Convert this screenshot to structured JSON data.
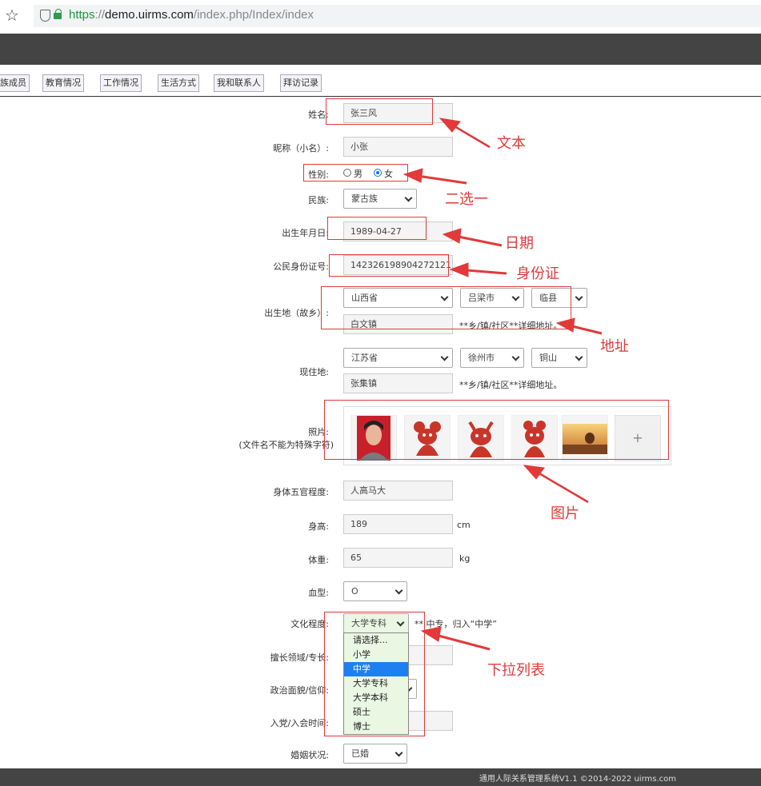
{
  "browser": {
    "url_scheme": "https",
    "url_sep": "://",
    "url_host": "demo.uirms.com",
    "url_path": "/index.php/Index/index"
  },
  "tabs": [
    "族成员",
    "教育情况",
    "工作情况",
    "生活方式",
    "我和联系人",
    "拜访记录"
  ],
  "form": {
    "name_label": "姓名:",
    "name_value": "张三风",
    "nickname_label": "昵称（小名）:",
    "nickname_value": "小张",
    "gender_label": "性别:",
    "gender_male": "男",
    "gender_female": "女",
    "gender_selected": "女",
    "ethnicity_label": "民族:",
    "ethnicity_value": "蒙古族",
    "birthdate_label": "出生年月日:",
    "birthdate_value": "1989-04-27",
    "idcard_label": "公民身份证号:",
    "idcard_value": "142326198904272121",
    "birthplace_label": "出生地（故乡）:",
    "birthplace_province": "山西省",
    "birthplace_city": "吕梁市",
    "birthplace_county": "临县",
    "birthplace_detail": "白文镇",
    "birthplace_note": "**乡/镇/社区**详细地址。",
    "residence_label": "现住地:",
    "residence_province": "江苏省",
    "residence_city": "徐州市",
    "residence_county": "铜山",
    "residence_detail": "张集镇",
    "residence_note": "**乡/镇/社区**详细地址。",
    "photo_label": "照片:",
    "photo_hint": "(文件名不能为特殊字符)",
    "photo_add": "+",
    "features_label": "身体五官程度:",
    "features_value": "人高马大",
    "height_label": "身高:",
    "height_value": "189",
    "height_unit": "cm",
    "weight_label": "体重:",
    "weight_value": "65",
    "weight_unit": "kg",
    "blood_label": "血型:",
    "blood_value": "O",
    "education_label": "文化程度:",
    "education_value": "大学专科",
    "education_note": "** 中专，归入“中学”",
    "specialty_label": "擅长领域/专长:",
    "political_label": "政治面貌/信仰:",
    "party_label": "入党/入会时间:",
    "marital_label": "婚姻状况:",
    "marital_value": "已婚"
  },
  "education_options": [
    "请选择...",
    "小学",
    "中学",
    "大学专科",
    "大学本科",
    "硕士",
    "博士"
  ],
  "education_highlighted": "中学",
  "annotations": {
    "text": "文本",
    "choice": "二选一",
    "date": "日期",
    "idcard": "身份证",
    "address": "地址",
    "image": "图片",
    "dropdown": "下拉列表"
  },
  "footer": "通用人际关系管理系统V1.1 ©2014-2022 uirms.com",
  "colors": {
    "annotation": "#e03a3a",
    "header_bar": "#444444",
    "highlight": "#1e80f0",
    "dropdown_bg": "#e9f7e3"
  }
}
